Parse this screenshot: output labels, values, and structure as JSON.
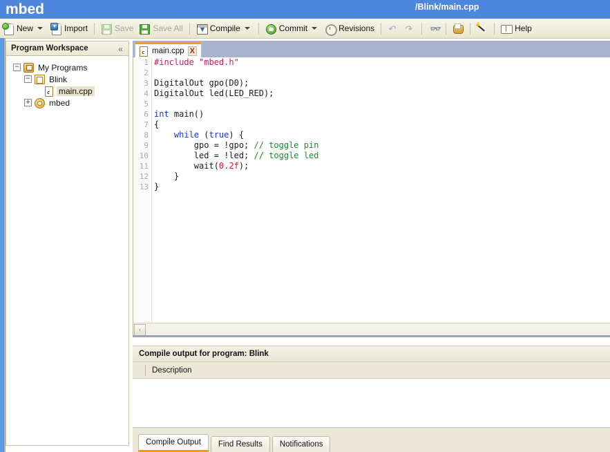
{
  "header": {
    "brand": "mbed",
    "path": "/Blink/main.cpp"
  },
  "toolbar": {
    "items": [
      {
        "label": "New",
        "icon": "new-file-icon",
        "caret": true,
        "disabled": false
      },
      {
        "label": "Import",
        "icon": "import-icon",
        "caret": false,
        "disabled": false
      },
      {
        "label": "Save",
        "icon": "save-icon",
        "caret": false,
        "disabled": true
      },
      {
        "label": "Save All",
        "icon": "save-all-icon",
        "caret": false,
        "disabled": true
      },
      {
        "label": "Compile",
        "icon": "compile-icon",
        "caret": true,
        "disabled": false
      },
      {
        "label": "Commit",
        "icon": "commit-icon",
        "caret": true,
        "disabled": false
      },
      {
        "label": "Revisions",
        "icon": "revisions-icon",
        "caret": false,
        "disabled": false
      },
      {
        "label": "Help",
        "icon": "help-icon",
        "caret": false,
        "disabled": false
      }
    ],
    "undo_label": "Undo",
    "redo_label": "Redo",
    "find_label": "Find",
    "cookbook_label": "Cookbook",
    "wand_label": "Wand"
  },
  "sidebar": {
    "title": "Program Workspace",
    "collapse_glyph": "«",
    "tree": [
      {
        "label": "My Programs",
        "icon": "programs-icon",
        "toggle": "−",
        "indent": 0,
        "selected": false
      },
      {
        "label": "Blink",
        "icon": "program-folder-icon",
        "toggle": "−",
        "indent": 1,
        "selected": false
      },
      {
        "label": "main.cpp",
        "icon": "cpp-file-icon",
        "toggle": "",
        "indent": 2,
        "selected": true
      },
      {
        "label": "mbed",
        "icon": "library-icon",
        "toggle": "+",
        "indent": 1,
        "selected": false
      }
    ]
  },
  "editor": {
    "tab": {
      "name": "main.cpp",
      "close_label": "X",
      "icon": "cpp-file-icon"
    },
    "scroll_left_glyph": "‹",
    "lines": [
      {
        "n": 1,
        "tokens": [
          {
            "t": "#include ",
            "c": "k-pre"
          },
          {
            "t": "\"mbed.h\"",
            "c": "k-str"
          }
        ]
      },
      {
        "n": 2,
        "tokens": []
      },
      {
        "n": 3,
        "tokens": [
          {
            "t": "DigitalOut gpo(D0);",
            "c": ""
          }
        ]
      },
      {
        "n": 4,
        "tokens": [
          {
            "t": "DigitalOut led(LED_RED);",
            "c": ""
          }
        ]
      },
      {
        "n": 5,
        "tokens": []
      },
      {
        "n": 6,
        "tokens": [
          {
            "t": "int",
            "c": "k-kw"
          },
          {
            "t": " main()",
            "c": ""
          }
        ]
      },
      {
        "n": 7,
        "tokens": [
          {
            "t": "{",
            "c": ""
          }
        ]
      },
      {
        "n": 8,
        "tokens": [
          {
            "t": "    ",
            "c": ""
          },
          {
            "t": "while",
            "c": "k-kw"
          },
          {
            "t": " (",
            "c": ""
          },
          {
            "t": "true",
            "c": "k-kw"
          },
          {
            "t": ") {",
            "c": ""
          }
        ]
      },
      {
        "n": 9,
        "tokens": [
          {
            "t": "        gpo = !gpo; ",
            "c": ""
          },
          {
            "t": "// toggle pin",
            "c": "k-cmt"
          }
        ]
      },
      {
        "n": 10,
        "tokens": [
          {
            "t": "        led = !led; ",
            "c": ""
          },
          {
            "t": "// toggle led",
            "c": "k-cmt"
          }
        ]
      },
      {
        "n": 11,
        "tokens": [
          {
            "t": "        wait(",
            "c": ""
          },
          {
            "t": "0.2f",
            "c": "k-num"
          },
          {
            "t": ");",
            "c": ""
          }
        ]
      },
      {
        "n": 12,
        "tokens": [
          {
            "t": "    }",
            "c": ""
          }
        ]
      },
      {
        "n": 13,
        "tokens": [
          {
            "t": "}",
            "c": ""
          }
        ]
      }
    ]
  },
  "output": {
    "title": "Compile output for program: Blink",
    "column_header": "Description",
    "rows": [],
    "tabs": [
      {
        "label": "Compile Output",
        "active": true
      },
      {
        "label": "Find Results",
        "active": false
      },
      {
        "label": "Notifications",
        "active": false
      }
    ]
  }
}
